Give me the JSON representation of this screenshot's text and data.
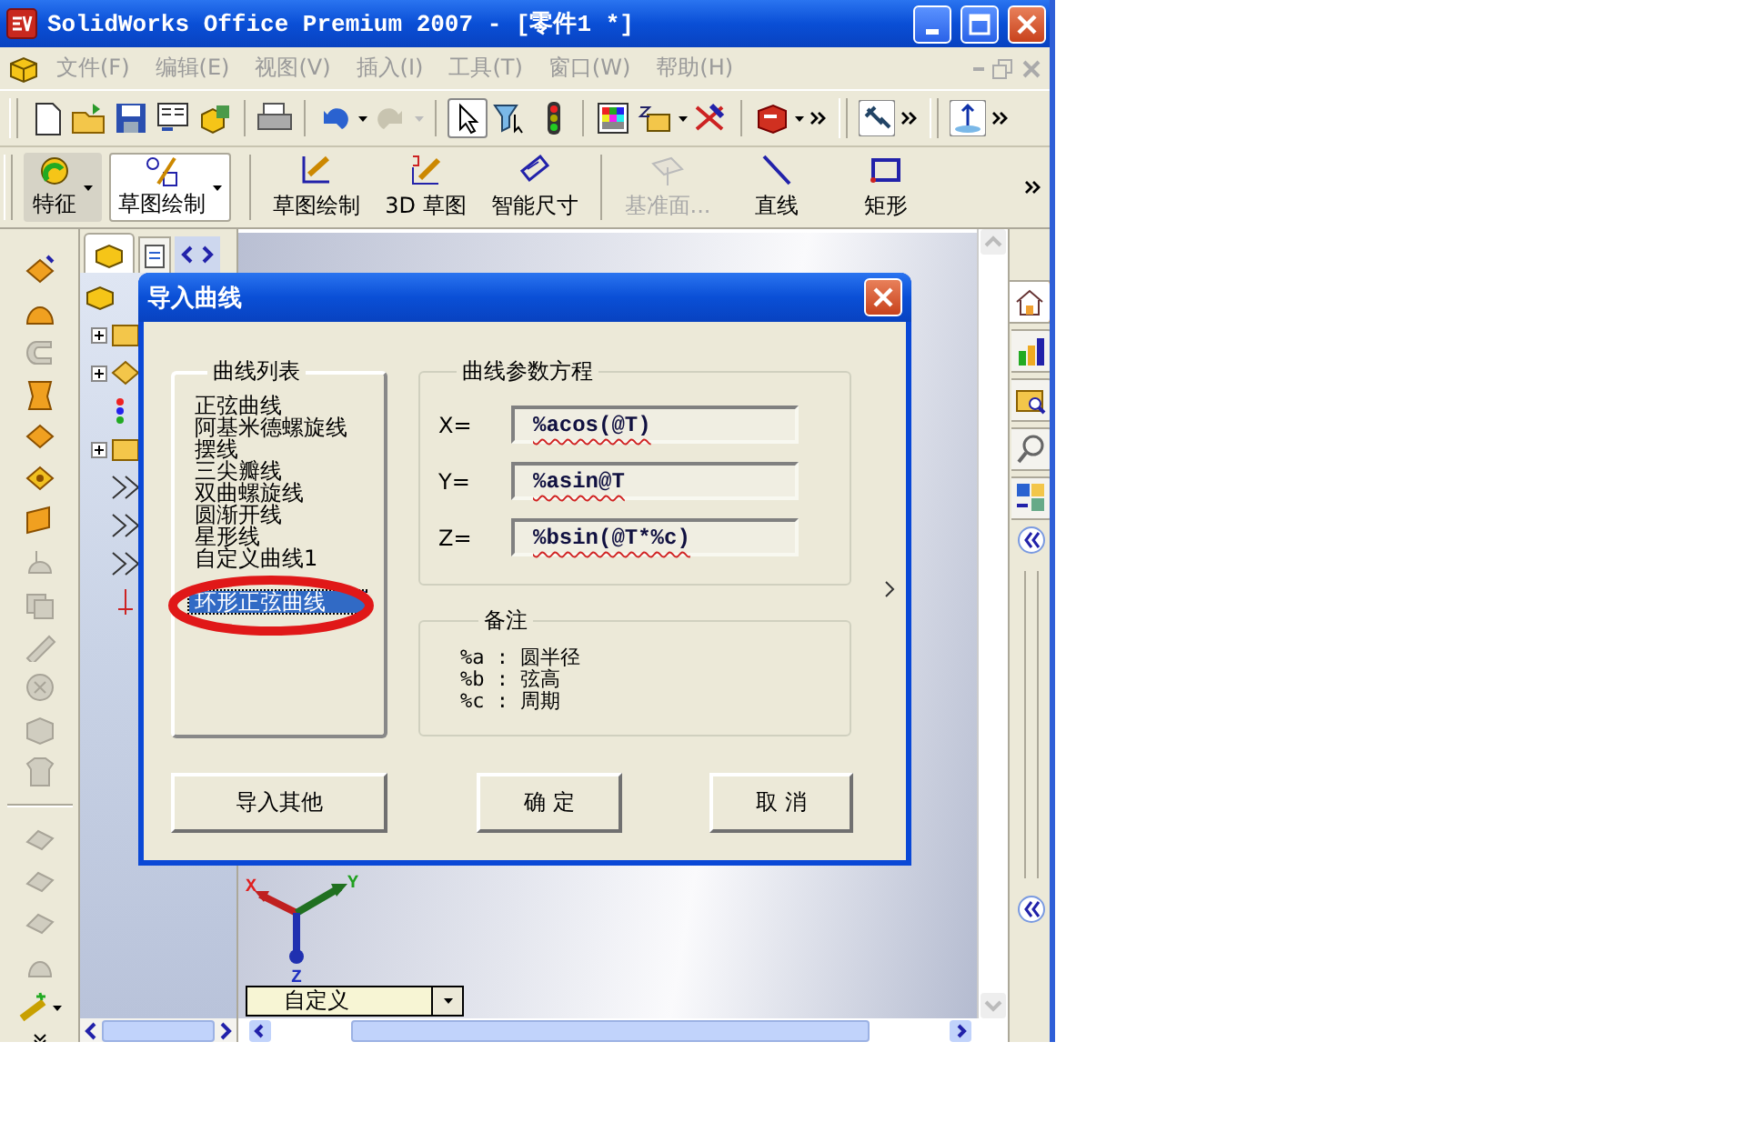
{
  "window": {
    "title": "SolidWorks Office Premium 2007 - [零件1 *]"
  },
  "menu": [
    {
      "label": "文件(F)",
      "disabled": true
    },
    {
      "label": "编辑(E)",
      "disabled": true
    },
    {
      "label": "视图(V)",
      "disabled": true
    },
    {
      "label": "插入(I)",
      "disabled": true
    },
    {
      "label": "工具(T)",
      "disabled": true
    },
    {
      "label": "窗口(W)",
      "disabled": true
    },
    {
      "label": "帮助(H)",
      "disabled": true
    }
  ],
  "command_manager": {
    "tabs": [
      {
        "label": "特征",
        "selected": false
      },
      {
        "label": "草图绘制",
        "selected": true
      }
    ],
    "buttons": [
      {
        "label": "草图绘制",
        "disabled": false
      },
      {
        "label": "3D 草图",
        "disabled": false
      },
      {
        "label": "智能尺寸",
        "disabled": false
      },
      {
        "label": "基准面...",
        "disabled": true
      },
      {
        "label": "直线",
        "disabled": false
      },
      {
        "label": "矩形",
        "disabled": false
      }
    ]
  },
  "task_pane": {
    "tabs": [
      {
        "selected": true
      },
      {
        "selected": false
      },
      {
        "selected": false
      },
      {
        "selected": false
      },
      {
        "selected": false
      }
    ]
  },
  "viewport": {
    "triad": {
      "x_label": "X",
      "y_label": "Y",
      "z_label": "Z"
    },
    "view_combo": {
      "value": "自定义"
    }
  },
  "dialog": {
    "title": "导入曲线",
    "curve_list": {
      "label": "曲线列表",
      "items": [
        {
          "label": "正弦曲线",
          "selected": false
        },
        {
          "label": "阿基米德螺旋线",
          "selected": false
        },
        {
          "label": "摆线",
          "selected": false
        },
        {
          "label": "三尖瓣线",
          "selected": false
        },
        {
          "label": "双曲螺旋线",
          "selected": false
        },
        {
          "label": "圆渐开线",
          "selected": false
        },
        {
          "label": "星形线",
          "selected": false
        },
        {
          "label": "自定义曲线1",
          "selected": false
        },
        {
          "label": "环形正弦曲线",
          "selected": true
        }
      ]
    },
    "equations": {
      "label": "曲线参数方程",
      "fields": [
        {
          "label": "X=",
          "value": "%acos(@T)"
        },
        {
          "label": "Y=",
          "value": "%asin@T"
        },
        {
          "label": "Z=",
          "value": "%bsin(@T*%c)"
        }
      ]
    },
    "notes": {
      "label": "备注",
      "lines": [
        "%a : 圆半径",
        "%b : 弦高",
        "%c : 周期"
      ]
    },
    "buttons": [
      "导入其他",
      "确 定",
      "取 消"
    ]
  }
}
